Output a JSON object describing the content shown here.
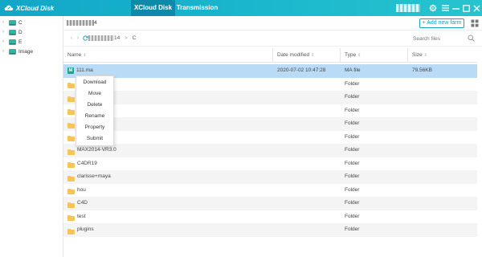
{
  "app": {
    "title": "XCloud Disk"
  },
  "tabs": [
    {
      "label": "XCloud Disk",
      "active": true
    },
    {
      "label": "Transmission",
      "active": false
    }
  ],
  "colors": {
    "accent": "#17a2c1",
    "titlebar": "#17b3cc",
    "selected_row": "#b9dbf6",
    "folder": "#f5c55a"
  },
  "sidebar": {
    "items": [
      {
        "label": "C",
        "icon": "drive-icon"
      },
      {
        "label": "D",
        "icon": "drive-icon"
      },
      {
        "label": "E",
        "icon": "drive-icon"
      },
      {
        "label": "Image",
        "icon": "drive-icon"
      }
    ]
  },
  "toolbar": {
    "breadcrumb_suffix": "4",
    "add_label": "+ Add new farm"
  },
  "nav": {
    "path_suffix": "14",
    "path_separator": ">",
    "path_current": "C",
    "search_placeholder": "Search files"
  },
  "table": {
    "headers": [
      {
        "label": "Name"
      },
      {
        "label": "Date modified"
      },
      {
        "label": "Type"
      },
      {
        "label": "Size"
      }
    ],
    "rows": [
      {
        "name": "111.ma",
        "date": "2020-07-02 10:47:28",
        "type": "MA file",
        "size": "79.56KB",
        "icon": "ma-file-icon",
        "selected": true
      },
      {
        "name": "",
        "date": "",
        "type": "Folder",
        "size": "",
        "icon": "folder-icon"
      },
      {
        "name": "",
        "date": "",
        "type": "Folder",
        "size": "",
        "icon": "folder-icon"
      },
      {
        "name": "",
        "date": "",
        "type": "Folder",
        "size": "",
        "icon": "folder-icon"
      },
      {
        "name": "",
        "date": "",
        "type": "Folder",
        "size": "",
        "icon": "folder-icon"
      },
      {
        "name": "",
        "date": "",
        "type": "Folder",
        "size": "",
        "icon": "folder-icon"
      },
      {
        "name": "MAX2014-VR3.0",
        "date": "",
        "type": "Folder",
        "size": "",
        "icon": "folder-icon"
      },
      {
        "name": "C4DR19",
        "date": "",
        "type": "Folder",
        "size": "",
        "icon": "folder-icon"
      },
      {
        "name": "clarisse+maya",
        "date": "",
        "type": "Folder",
        "size": "",
        "icon": "folder-icon"
      },
      {
        "name": "hou",
        "date": "",
        "type": "Folder",
        "size": "",
        "icon": "folder-icon"
      },
      {
        "name": "C4D",
        "date": "",
        "type": "Folder",
        "size": "",
        "icon": "folder-icon"
      },
      {
        "name": "test",
        "date": "",
        "type": "Folder",
        "size": "",
        "icon": "folder-icon"
      },
      {
        "name": "plugins",
        "date": "",
        "type": "Folder",
        "size": "",
        "icon": "folder-icon"
      }
    ]
  },
  "context_menu": {
    "items": [
      "Download",
      "Move",
      "Delete",
      "Rename",
      "Property",
      "Submit"
    ]
  }
}
